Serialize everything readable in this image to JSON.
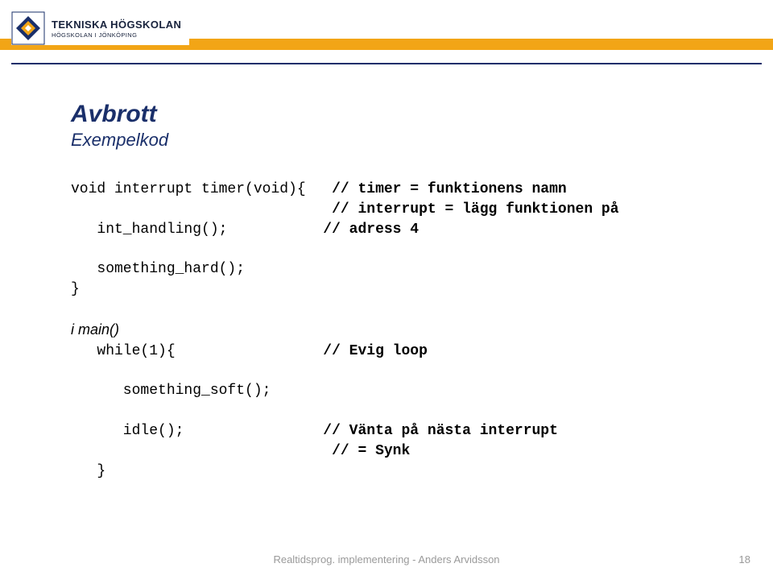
{
  "logo": {
    "top": "TEKNISKA HÖGSKOLAN",
    "bottom": "HÖGSKOLAN I JÖNKÖPING"
  },
  "title": "Avbrott",
  "subtitle": "Exempelkod",
  "code": {
    "l1a": "void interrupt timer(void){",
    "l1c": "// timer = funktionens namn",
    "l2c": "// interrupt = lägg funktionen på",
    "l3a": "   int_handling();",
    "l3c": "// adress 4",
    "l5a": "   something_hard();",
    "l6a": "}",
    "l8a": "i main()",
    "l9a": "   while(1){",
    "l9c": "// Evig loop",
    "l11a": "      something_soft();",
    "l13a": "      idle();",
    "l13c": "// Vänta på nästa interrupt",
    "l14c": "// = Synk",
    "l15a": "   }"
  },
  "footer": "Realtidsprog. implementering - Anders Arvidsson",
  "page": "18"
}
